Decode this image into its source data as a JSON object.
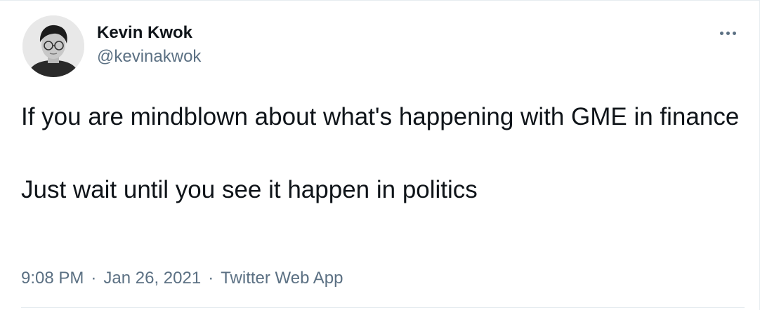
{
  "user": {
    "name": "Kevin Kwok",
    "handle": "@kevinakwok"
  },
  "tweet": {
    "text": "If you are mindblown about what's happening with GME in finance\n\nJust wait until you see it happen in politics"
  },
  "meta": {
    "time": "9:08 PM",
    "separator": "·",
    "date": "Jan 26, 2021",
    "source": "Twitter Web App"
  },
  "icons": {
    "more": "more-horizontal-icon"
  },
  "colors": {
    "text": "#0f1419",
    "secondary": "#5b7083",
    "border": "#e6ecf0"
  }
}
